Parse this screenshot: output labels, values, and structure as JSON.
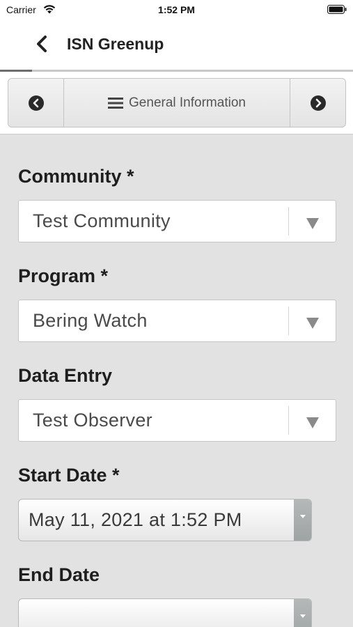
{
  "status_bar": {
    "carrier": "Carrier",
    "time": "1:52 PM"
  },
  "nav": {
    "title": "ISN Greenup",
    "progress_fraction": 0.09
  },
  "section": {
    "label": "General Information"
  },
  "fields": {
    "community": {
      "label": "Community *",
      "value": "Test Community"
    },
    "program": {
      "label": "Program *",
      "value": "Bering Watch"
    },
    "data_entry": {
      "label": "Data Entry",
      "value": "Test Observer"
    },
    "start_date": {
      "label": "Start Date *",
      "value": "May 11, 2021 at 1:52 PM"
    },
    "end_date": {
      "label": "End Date",
      "value": ""
    }
  },
  "colors": {
    "background": "#e2e2e2",
    "header": "#ffffff",
    "spinner": "#a9aeae"
  },
  "icons": [
    "wifi-icon",
    "battery-icon",
    "back-chevron-icon",
    "previous-circle-icon",
    "hamburger-menu-icon",
    "next-circle-icon",
    "dropdown-arrow-icon"
  ]
}
